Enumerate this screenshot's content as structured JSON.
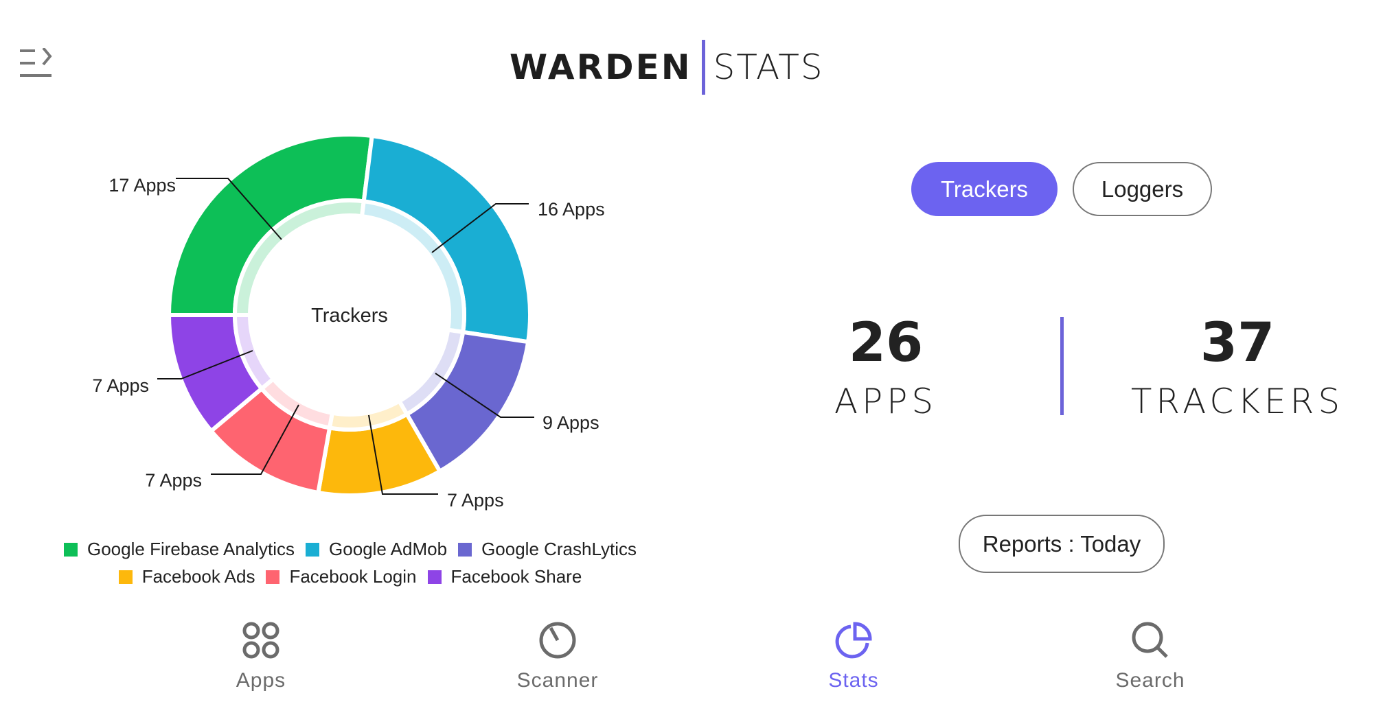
{
  "header": {
    "title_bold": "WARDEN",
    "title_light": "STATS",
    "menu_icon": "menu-expand-icon"
  },
  "colors": {
    "accent": "#6c63f0",
    "divider": "#6c63d9",
    "nav_inactive": "#6b6b6b"
  },
  "chart_data": {
    "type": "pie",
    "center_label": "Trackers",
    "unit_label": "Apps",
    "slices": [
      {
        "name": "Google Firebase Analytics",
        "value": 17,
        "label": "17 Apps",
        "color": "#0dbf57"
      },
      {
        "name": "Google AdMob",
        "value": 16,
        "label": "16 Apps",
        "color": "#1aaed3"
      },
      {
        "name": "Google CrashLytics",
        "value": 9,
        "label": "9 Apps",
        "color": "#6a67d0"
      },
      {
        "name": "Facebook Ads",
        "value": 7,
        "label": "7 Apps",
        "color": "#fdb80c"
      },
      {
        "name": "Facebook Login",
        "value": 7,
        "label": "7 Apps",
        "color": "#fe6470"
      },
      {
        "name": "Facebook Share",
        "value": 7,
        "label": "7 Apps",
        "color": "#8e44e6"
      }
    ]
  },
  "toggle": {
    "trackers": "Trackers",
    "loggers": "Loggers",
    "selected": "Trackers"
  },
  "stats": {
    "apps_value": "26",
    "apps_label": "APPS",
    "trackers_value": "37",
    "trackers_label": "TRACKERS"
  },
  "reports": {
    "label": "Reports : Today"
  },
  "nav": [
    {
      "label": "Apps",
      "icon": "apps-grid-icon"
    },
    {
      "label": "Scanner",
      "icon": "scanner-gauge-icon"
    },
    {
      "label": "Stats",
      "icon": "pie-chart-icon",
      "active": true
    },
    {
      "label": "Search",
      "icon": "search-icon"
    }
  ]
}
